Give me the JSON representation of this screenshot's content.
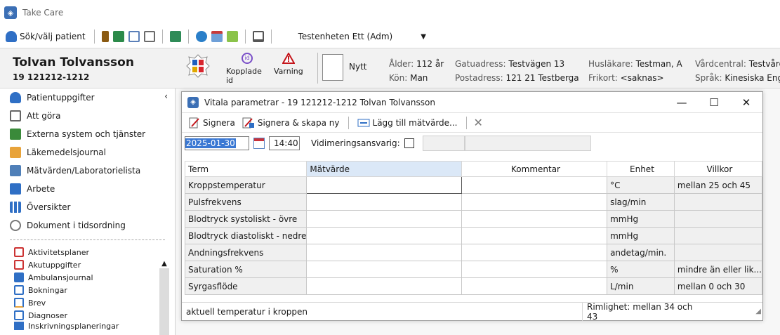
{
  "app": {
    "title": "Take Care"
  },
  "toolbar": {
    "patient_button": "Sök/välj patient",
    "unit_select": "Testenheten Ett (Adm)"
  },
  "patient": {
    "name": "Tolvan Tolvansson",
    "pnr": "19 121212-1212",
    "buttons": {
      "linked_id": "Kopplade id",
      "warning": "Varning",
      "new": "Nytt"
    },
    "info": {
      "age_label": "Ålder:",
      "age_value": "112 år",
      "gender_label": "Kön:",
      "gender_value": "Man",
      "street_label": "Gatuadress:",
      "street_value": "Testvägen 13",
      "postal_label": "Postadress:",
      "postal_value": "121 21 Testberga",
      "doctor_label": "Husläkare:",
      "doctor_value": "Testman, A",
      "freecard_label": "Frikort:",
      "freecard_value": "<saknas>",
      "care_label": "Vårdcentral:",
      "care_value": "Testvård",
      "lang_label": "Språk:",
      "lang_value": "Kinesiska Engel"
    }
  },
  "sidebar": {
    "items": [
      {
        "label": "Patientuppgifter",
        "icon": "person-icon"
      },
      {
        "label": "Att göra",
        "icon": "checklist-icon"
      },
      {
        "label": "Externa system och tjänster",
        "icon": "network-icon"
      },
      {
        "label": "Läkemedelsjournal",
        "icon": "medication-icon"
      },
      {
        "label": "Mätvärden/Laboratorielista",
        "icon": "lab-icon"
      },
      {
        "label": "Arbete",
        "icon": "work-icon"
      },
      {
        "label": "Översikter",
        "icon": "grid-icon"
      },
      {
        "label": "Dokument i tidsordning",
        "icon": "document-search-icon"
      }
    ],
    "small_items": [
      {
        "label": "Aktivitetsplaner"
      },
      {
        "label": "Akutuppgifter"
      },
      {
        "label": "Ambulansjournal"
      },
      {
        "label": "Bokningar"
      },
      {
        "label": "Brev"
      },
      {
        "label": "Diagnoser"
      },
      {
        "label": "Inskrivningsplaneringar"
      }
    ]
  },
  "dialog": {
    "title": "Vitala parametrar -  19 121212-1212 Tolvan Tolvansson",
    "toolbar": {
      "sign": "Signera",
      "sign_new": "Signera & skapa ny",
      "add_value": "Lägg till mätvärde..."
    },
    "date": "2025-01-30",
    "time": "14:40",
    "vidimering_label": "Vidimeringsansvarig:",
    "columns": {
      "term": "Term",
      "value": "Mätvärde",
      "comment": "Kommentar",
      "unit": "Enhet",
      "condition": "Villkor"
    },
    "rows": [
      {
        "term": "Kroppstemperatur",
        "value": "",
        "comment": "",
        "unit": "°C",
        "condition": "mellan 25 och 45"
      },
      {
        "term": "Pulsfrekvens",
        "value": "",
        "comment": "",
        "unit": "slag/min",
        "condition": ""
      },
      {
        "term": "Blodtryck systoliskt - övre",
        "value": "",
        "comment": "",
        "unit": "mmHg",
        "condition": ""
      },
      {
        "term": "Blodtryck diastoliskt - nedre",
        "value": "",
        "comment": "",
        "unit": "mmHg",
        "condition": ""
      },
      {
        "term": "Andningsfrekvens",
        "value": "",
        "comment": "",
        "unit": "andetag/min.",
        "condition": ""
      },
      {
        "term": "Saturation %",
        "value": "",
        "comment": "",
        "unit": "%",
        "condition": "mindre än eller lik..."
      },
      {
        "term": "Syrgasflöde",
        "value": "",
        "comment": "",
        "unit": "L/min",
        "condition": "mellan 0 och 30"
      }
    ],
    "status_left": "aktuell temperatur i kroppen",
    "status_right": "Rimlighet: mellan 34 och 43"
  }
}
